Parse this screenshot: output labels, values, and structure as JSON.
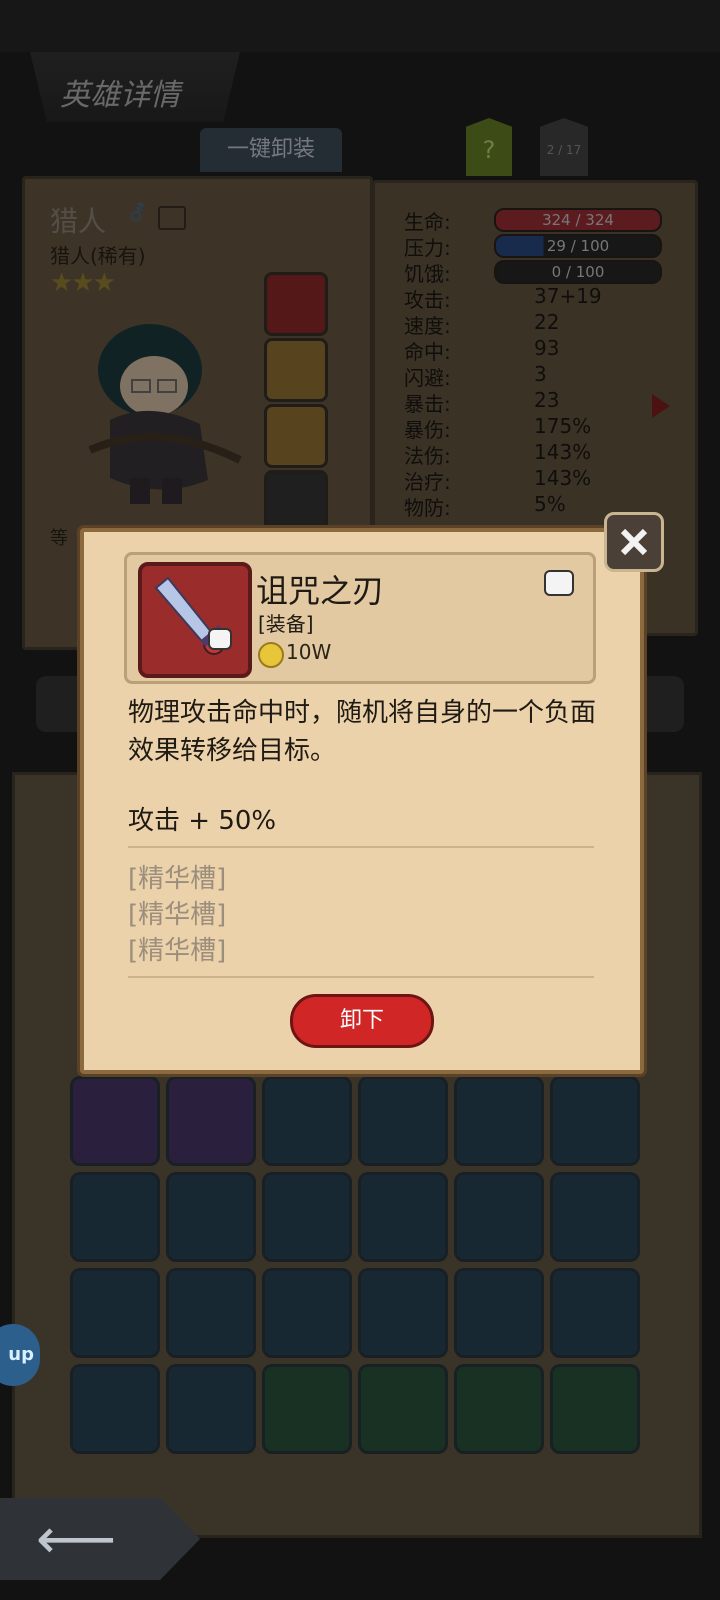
{
  "header": {
    "title": "英雄详情",
    "unequip_all": "一键卸装",
    "help": "?",
    "page": "2 / 17"
  },
  "hero": {
    "name": "猎人",
    "gender_icon": "male-icon",
    "subtitle": "猎人(稀有)",
    "stars": "★★★",
    "level_label": "等"
  },
  "stats": {
    "labels": [
      "生命:",
      "压力:",
      "饥饿:",
      "攻击:",
      "速度:",
      "命中:",
      "闪避:",
      "暴击:",
      "暴伤:",
      "法伤:",
      "治疗:",
      "物防:"
    ],
    "hp": "324 / 324",
    "stress": "29 / 100",
    "hunger": "0 / 100",
    "attack": "37+19",
    "speed": "22",
    "hit": "93",
    "dodge": "3",
    "crit": "23",
    "crit_damage": "175%",
    "magic_damage": "143%",
    "heal": "143%",
    "phys_def": "5%",
    "hp_fill": 1.0,
    "stress_fill": 0.29,
    "hunger_fill": 0.0,
    "colors": {
      "hp": "#a8323a",
      "stress": "#2f4f8a",
      "hunger": "#3a3a3a"
    }
  },
  "popup": {
    "item_name": "诅咒之刃",
    "item_type": "[装备]",
    "price": "10W",
    "description": "物理攻击命中时，随机将自身的一个负面效果转移给目标。",
    "effect": "攻击 + 50%",
    "slots": [
      "[精华槽]",
      "[精华槽]",
      "[精华槽]"
    ],
    "unequip_button": "卸下"
  },
  "side_tab": {
    "label": "up"
  }
}
